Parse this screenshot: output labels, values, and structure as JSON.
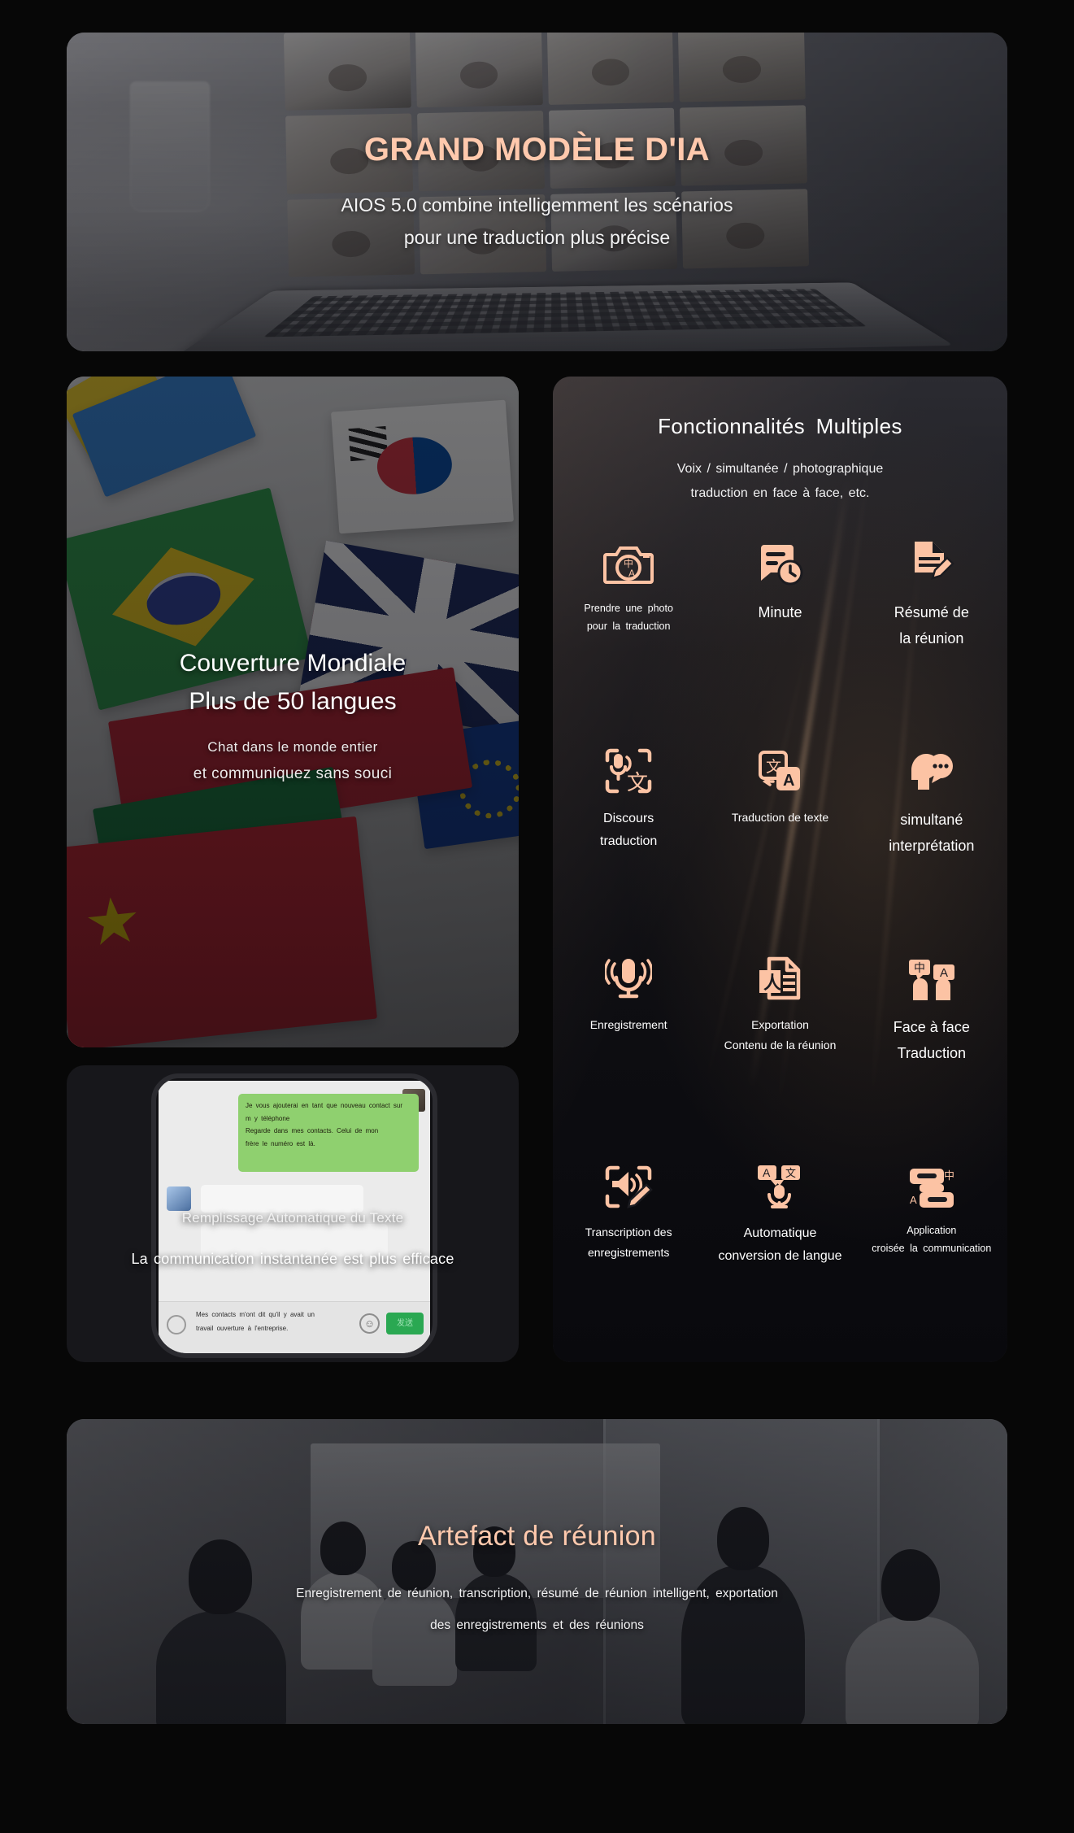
{
  "hero": {
    "title": "GRAND MODÈLE D'IA",
    "subtitle_line1": "AIOS 5.0 combine intelligemment les scénarios",
    "subtitle_line2": "pour une traduction plus précise",
    "title_color": "#ffc9ad"
  },
  "coverage": {
    "title_line1": "Couverture Mondiale",
    "title_line2": "Plus de 50 langues",
    "sub_line1": "Chat dans le monde entier",
    "sub_line2": "et communiquez sans souci"
  },
  "phone": {
    "bubble_green_line1": "Je vous ajouterai en tant que nouveau contact sur",
    "bubble_green_line2": "m y téléphone",
    "bubble_green_line3": "Regarde dans mes contacts. Celui de mon",
    "bubble_green_line4": "frère le numéro est là.",
    "input_line1": "Mes contacts m'ont dit qu'il y avait un",
    "input_line2": "travail ouverture à l'entreprise.",
    "send_label": "发送",
    "overlay_title": "Remplissage Automatique du Texte",
    "overlay_sub": "La communication instantanée est plus efficace"
  },
  "features": {
    "title": "Fonctionnalités  Multiples",
    "sub_line1": "Voix / simultanée / photographique",
    "sub_line2": "traduction en face à face, etc.",
    "items": [
      {
        "icon": "camera-translate-icon",
        "line1": "Prendre  une  photo",
        "line2": "pour la traduction",
        "size": "sz-xs"
      },
      {
        "icon": "minutes-clock-icon",
        "line1": "Minute",
        "line2": "",
        "size": "sz-l"
      },
      {
        "icon": "summary-edit-icon",
        "line1": "Résumé de",
        "line2": "la  réunion",
        "size": "sz-l"
      },
      {
        "icon": "speech-translate-icon",
        "line1": "Discours",
        "line2": "traduction",
        "size": "sz-m"
      },
      {
        "icon": "text-translate-icon",
        "line1": "Traduction de texte",
        "line2": "",
        "size": "sz-s"
      },
      {
        "icon": "simultaneous-head-icon",
        "line1": "simultané",
        "line2": "interprétation",
        "size": "sz-l"
      },
      {
        "icon": "microphone-record-icon",
        "line1": "Enregistrement",
        "line2": "",
        "size": "sz-s"
      },
      {
        "icon": "export-pdf-icon",
        "line1": "Exportation",
        "line2": "Contenu de la réunion",
        "size": "sz-s"
      },
      {
        "icon": "face-to-face-icon",
        "line1": "Face à face",
        "line2": "Traduction",
        "size": "sz-l"
      },
      {
        "icon": "transcription-pen-icon",
        "line1": "Transcription  des",
        "line2": "enregistrements",
        "size": "sz-s"
      },
      {
        "icon": "auto-language-mic-icon",
        "line1": "Automatique",
        "line2": "conversion de langue",
        "size": "sz-m"
      },
      {
        "icon": "cross-app-icon",
        "line1": "Application",
        "line2": "croisée  la  communication",
        "size": "sz-xs"
      }
    ]
  },
  "banner": {
    "title": "Artefact de réunion",
    "sub_line1": "Enregistrement  de  réunion,  transcription,  résumé  de  réunion  intelligent,  exportation",
    "sub_line2": "des  enregistrements  et  des  réunions",
    "title_color": "#ffc9ad"
  }
}
